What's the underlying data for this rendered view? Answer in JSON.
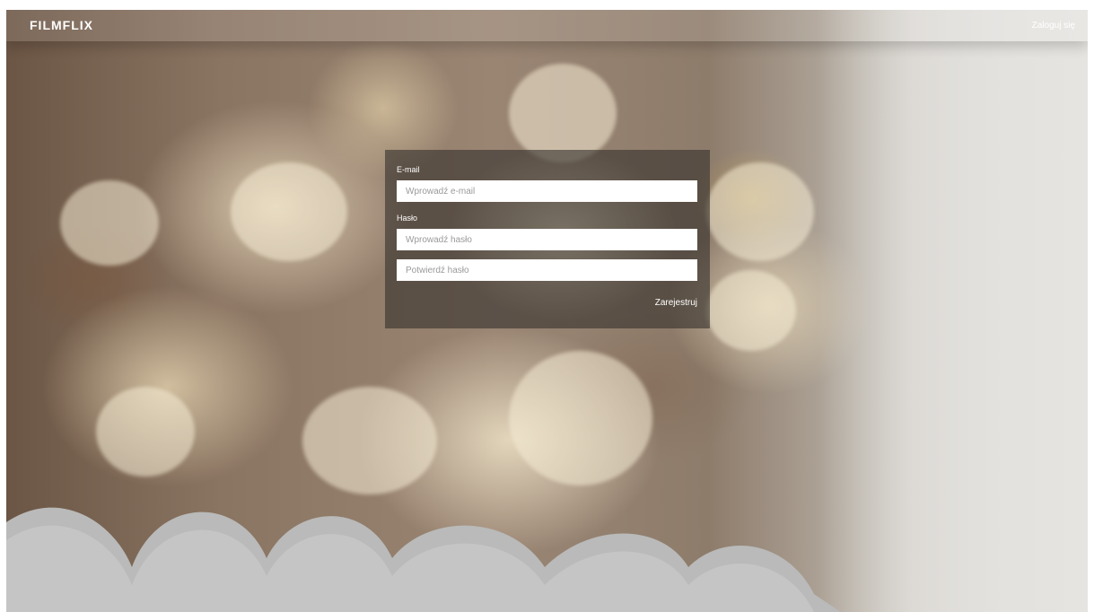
{
  "navbar": {
    "brand": "FILMFLIX",
    "login_link": "Zaloguj się"
  },
  "form": {
    "email_label": "E-mail",
    "email_placeholder": "Wprowadź e-mail",
    "email_value": "",
    "password_label": "Hasło",
    "password_placeholder": "Wprowadź hasło",
    "password_value": "",
    "confirm_placeholder": "Potwierdź hasło",
    "confirm_value": "",
    "submit_label": "Zarejestruj"
  },
  "background": {
    "subject": "popcorn-background-image"
  }
}
